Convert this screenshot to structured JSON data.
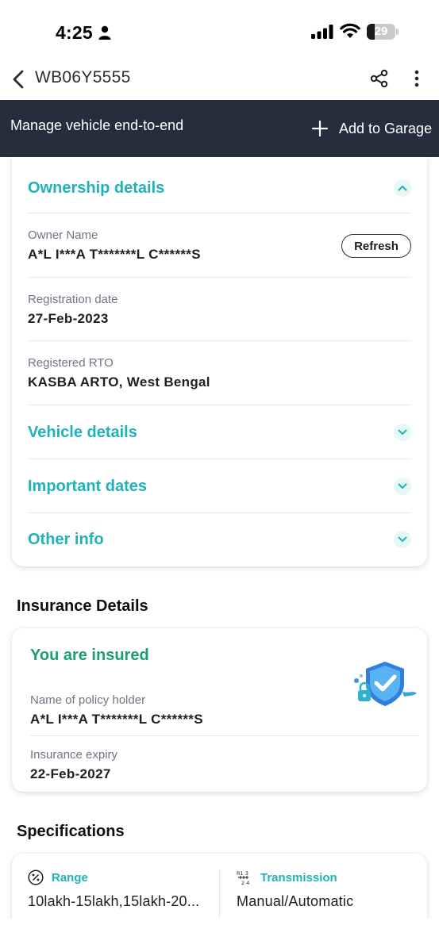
{
  "status_bar": {
    "time": "4:25",
    "battery_level": "29",
    "battery_fraction": 0.29,
    "icons": [
      "person-icon",
      "signal-icon",
      "wifi-icon",
      "battery-icon"
    ]
  },
  "header": {
    "title": "WB06Y5555",
    "icons": [
      "back-icon",
      "share-icon",
      "more-icon"
    ]
  },
  "banner": {
    "text": "Manage vehicle end-to-end",
    "add_button_label": "Add to Garage"
  },
  "ownership": {
    "title": "Ownership details",
    "expanded": true,
    "owner_label": "Owner Name",
    "owner_value": "A*L I***A T*******L C******S",
    "refresh_label": "Refresh",
    "reg_date_label": "Registration date",
    "reg_date_value": "27-Feb-2023",
    "rto_label": "Registered RTO",
    "rto_value": "KASBA ARTO, West Bengal"
  },
  "collapsed_sections": [
    {
      "title": "Vehicle details"
    },
    {
      "title": "Important dates"
    },
    {
      "title": "Other info"
    }
  ],
  "insurance": {
    "heading": "Insurance Details",
    "status": "You are insured",
    "holder_label": "Name of policy holder",
    "holder_value": "A*L I***A T*******L C******S",
    "expiry_label": "Insurance expiry",
    "expiry_value": "22-Feb-2027"
  },
  "specifications": {
    "heading": "Specifications",
    "items": [
      {
        "label": "Range",
        "value": "10lakh-15lakh,15lakh-20...",
        "icon": "percent-icon"
      },
      {
        "label": "Transmission",
        "value": "Manual/Automatic",
        "icon": "gear-pattern-icon"
      }
    ]
  },
  "colors": {
    "teal": "#1fb3b8",
    "green": "#1b9e78",
    "banner": "#262d3c"
  }
}
